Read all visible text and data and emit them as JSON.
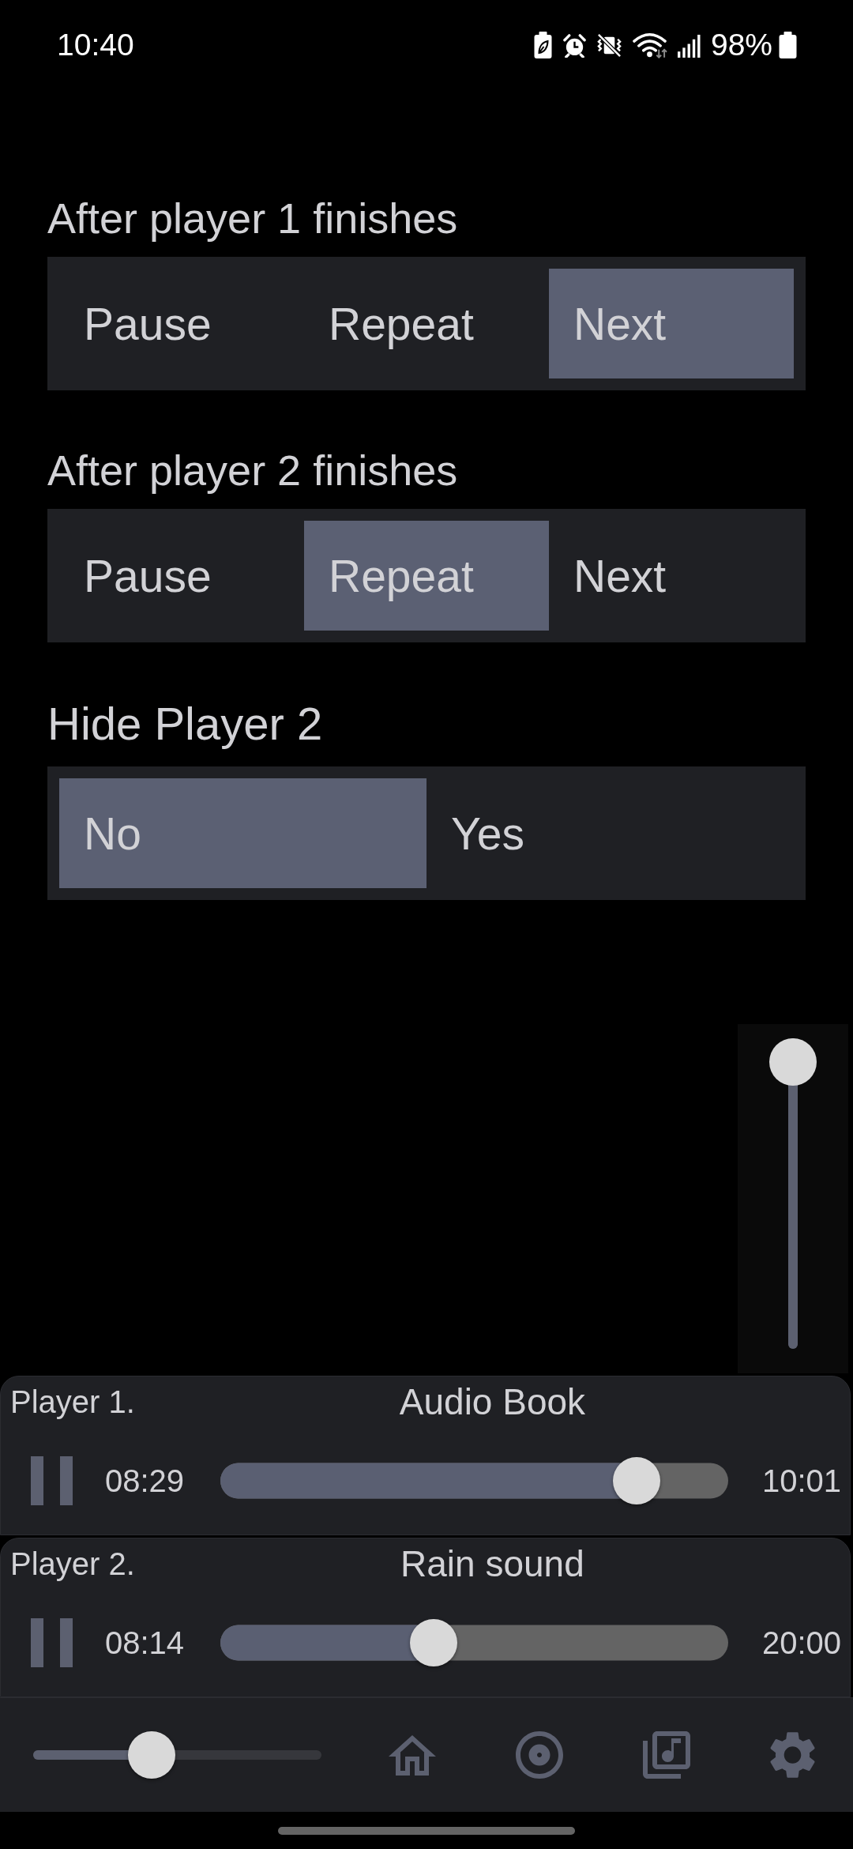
{
  "status_bar": {
    "time": "10:40",
    "battery": "98%"
  },
  "settings": [
    {
      "kind": "segmented",
      "label": "After player 1 finishes",
      "options": [
        {
          "label": "Pause",
          "selected": false
        },
        {
          "label": "Repeat",
          "selected": false
        },
        {
          "label": "Next",
          "selected": true
        }
      ]
    },
    {
      "kind": "segmented",
      "label": "After player 2 finishes",
      "options": [
        {
          "label": "Pause",
          "selected": false
        },
        {
          "label": "Repeat",
          "selected": true
        },
        {
          "label": "Next",
          "selected": false
        }
      ]
    },
    {
      "kind": "toggle",
      "label": "Hide Player 2",
      "options": [
        {
          "label": "No",
          "selected": true
        },
        {
          "label": "Yes",
          "selected": false
        }
      ]
    }
  ],
  "side_slider": {
    "level": 1
  },
  "players": [
    {
      "name": "Player 1.",
      "title": "Audio Book",
      "playing": true,
      "elapsed": "08:29",
      "level": 0.82,
      "duration": "10:01"
    },
    {
      "name": "Player 2.",
      "title": "Rain sound",
      "playing": true,
      "elapsed": "08:14",
      "level": 0.42,
      "duration": "20:00"
    }
  ],
  "bottom_bar": {
    "slider": {
      "level": 0.41
    }
  }
}
